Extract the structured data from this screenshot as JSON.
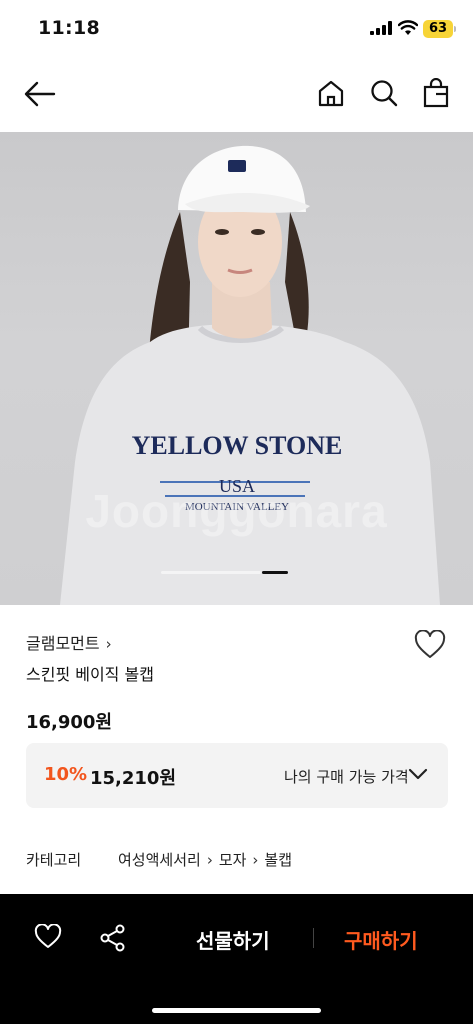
{
  "status_bar": {
    "time": "11:18",
    "battery": "63",
    "icons": [
      "signal-icon",
      "wifi-icon",
      "battery-icon"
    ],
    "battery_color": "#f7d437"
  },
  "nav": {
    "icons": [
      "back-arrow-icon",
      "home-icon",
      "search-icon",
      "shopping-bag-icon"
    ]
  },
  "product_image": {
    "watermark": "Joonggonara",
    "sweatshirt_text_line1": "YELLOW STONE",
    "sweatshirt_text_line2": "USA",
    "sweatshirt_text_line3": "MOUNTAIN VALLEY",
    "carousel_pages": 2,
    "carousel_current": 2
  },
  "product": {
    "brand": "글램모먼트",
    "brand_chevron": "›",
    "name": "스킨핏 베이직 볼캡",
    "price": "16,900원",
    "discount_rate": "10%",
    "discount_price": "15,210원",
    "my_price_label": "나의 구매 가능 가격"
  },
  "category": {
    "label": "카테고리",
    "path": [
      "여성액세서리",
      "모자",
      "볼캡"
    ],
    "separator": "›"
  },
  "bottom_bar": {
    "gift_label": "선물하기",
    "buy_label": "구매하기",
    "icons": [
      "heart-icon",
      "share-icon"
    ]
  },
  "colors": {
    "accent": "#f2551d",
    "buy_button": "#ff5a1f",
    "bottom_bar_bg": "#000000",
    "discount_box_bg": "#f3f3f3"
  }
}
